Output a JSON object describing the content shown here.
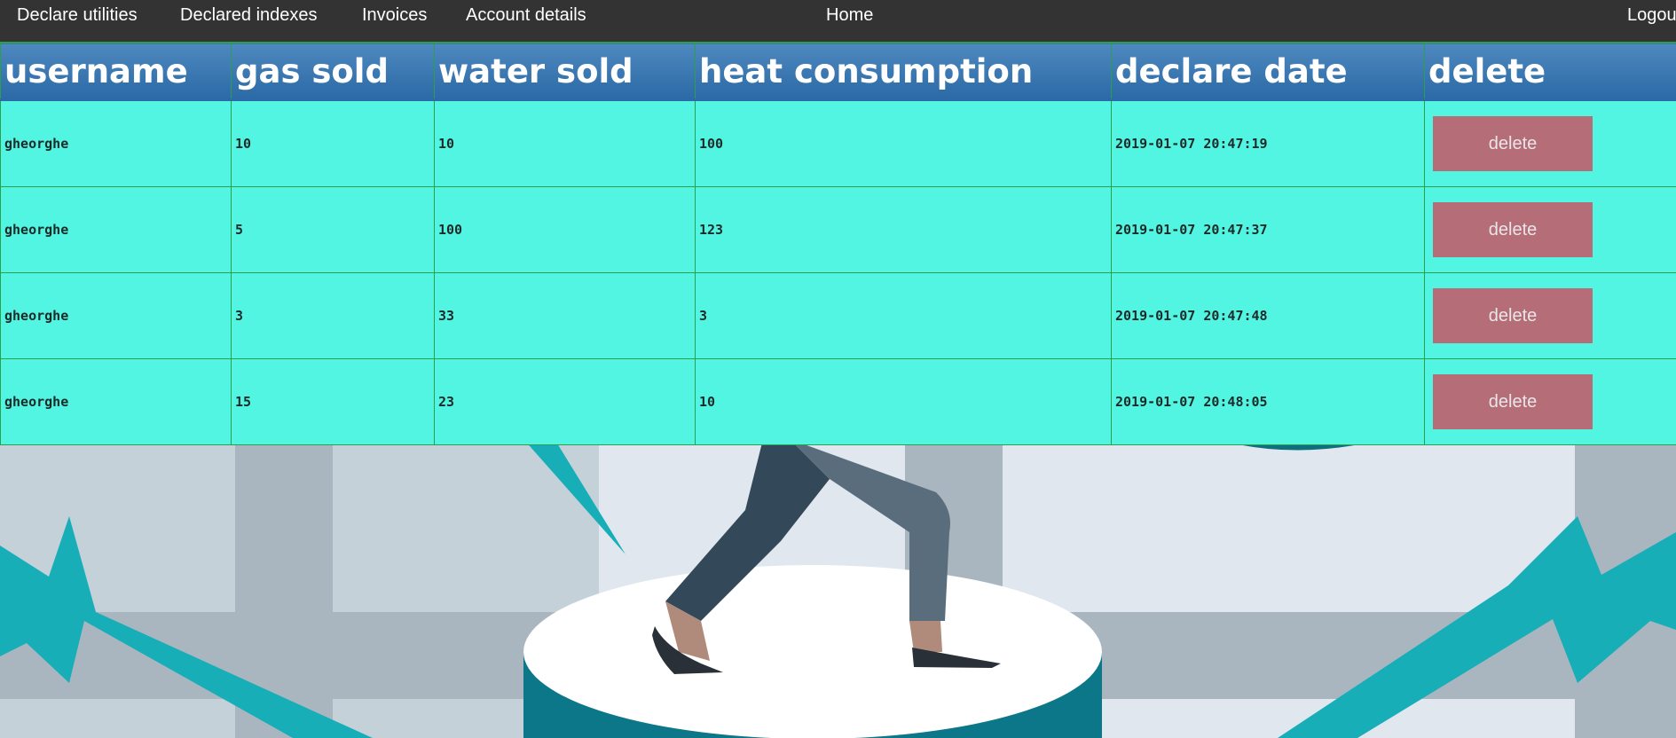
{
  "nav": {
    "items": [
      {
        "label": "Declare utilities"
      },
      {
        "label": "Declared indexes"
      },
      {
        "label": "Invoices"
      },
      {
        "label": "Account details"
      }
    ],
    "home": "Home",
    "logout": "Logou"
  },
  "table": {
    "headers": [
      "username",
      "gas sold",
      "water sold",
      "heat consumption",
      "declare date",
      "delete"
    ],
    "rows": [
      {
        "username": "gheorghe",
        "gas": "10",
        "water": "10",
        "heat": "100",
        "date": "2019-01-07 20:47:19",
        "action": "delete"
      },
      {
        "username": "gheorghe",
        "gas": "5",
        "water": "100",
        "heat": "123",
        "date": "2019-01-07 20:47:37",
        "action": "delete"
      },
      {
        "username": "gheorghe",
        "gas": "3",
        "water": "33",
        "heat": "3",
        "date": "2019-01-07 20:47:48",
        "action": "delete"
      },
      {
        "username": "gheorghe",
        "gas": "15",
        "water": "23",
        "heat": "10",
        "date": "2019-01-07 20:48:05",
        "action": "delete"
      }
    ]
  },
  "colors": {
    "nav_bg": "#333333",
    "header_bg": "#3a78b2",
    "row_bg": "#52f5e2",
    "border": "#2aa04a",
    "delete_button": "#b56d78"
  },
  "background": {
    "icon": "walking-person-lightning-illustration"
  }
}
